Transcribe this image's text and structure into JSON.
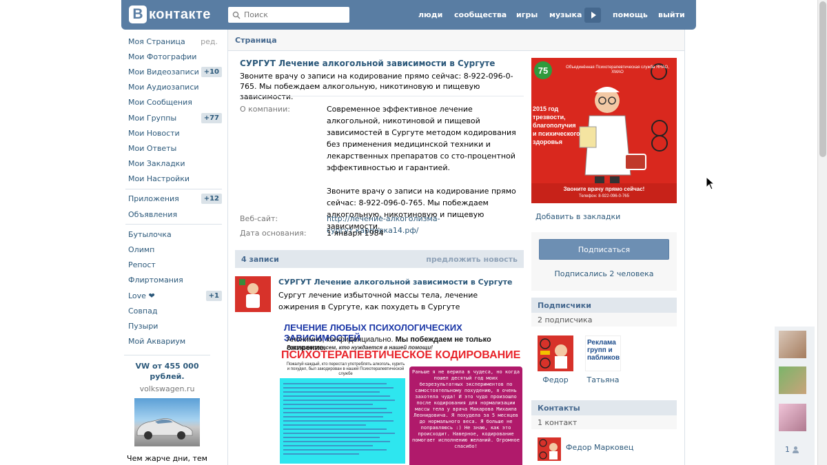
{
  "header": {
    "logo_letter": "В",
    "logo_text": "контакте",
    "search_placeholder": "Поиск",
    "nav": [
      "люди",
      "сообщества",
      "игры",
      "музыка",
      "помощь",
      "выйти"
    ]
  },
  "left_menu": {
    "group1": [
      {
        "label": "Моя Страница",
        "extra": "ред."
      },
      {
        "label": "Мои Фотографии"
      },
      {
        "label": "Мои Видеозаписи",
        "count": "+10"
      },
      {
        "label": "Мои Аудиозаписи"
      },
      {
        "label": "Мои Сообщения"
      },
      {
        "label": "Мои Группы",
        "count": "+77"
      },
      {
        "label": "Мои Новости"
      },
      {
        "label": "Мои Ответы"
      },
      {
        "label": "Мои Закладки"
      },
      {
        "label": "Мои Настройки"
      }
    ],
    "group2": [
      {
        "label": "Приложения",
        "count": "+12"
      },
      {
        "label": "Объявления"
      }
    ],
    "group3": [
      {
        "label": "Бутылочка"
      },
      {
        "label": "Олимп"
      },
      {
        "label": "Репост"
      },
      {
        "label": "Флиртомания"
      },
      {
        "label": "Love ❤",
        "count": "+1"
      },
      {
        "label": "Совпад"
      },
      {
        "label": "Пузыри"
      },
      {
        "label": "Мой Аквариум"
      }
    ]
  },
  "ad": {
    "title": "VW от 455 000 рублей.",
    "domain": "volkswagen.ru",
    "text": "Чем жарче дни, тем"
  },
  "main": {
    "bar_title": "Страница",
    "page_title": "СУРГУТ Лечение алкогольной зависимости в Сургуте",
    "status": "Звоните врачу о записи на кодирование прямо сейчас: 8-922-096-0-765. Мы побеждаем алкогольную, никотиновую и пищевую зависимости.",
    "about_label": "О компании:",
    "about_p1": "Современное эффективное лечение алкогольной, никотиновой и пищевой зависимостей в Сургуте методом кодирования без применения медицинской техники и лекарственных препаратов со сто-процентной эффективностью и гарантией.",
    "about_p2": "Звоните врачу о записи на кодирование прямо сейчас: 8-922-096-0-765. Мы побеждаем алкогольную, никотиновую и пищевую зависимости.",
    "website_label": "Веб-сайт:",
    "website": "http://лечение-алкоголизма-сургут.карповка14.рф/",
    "founded_label": "Дата основания:",
    "founded": "1 января 1984"
  },
  "posts": {
    "count_label": "4 записи",
    "suggest_label": "предложить новость",
    "post": {
      "author": "СУРГУТ Лечение алкогольной зависимости в Сургуте",
      "text": "Сургут лечение избыточной массы тела, лечение ожирения в Сургуте, как похудеть в Сургуте",
      "image": {
        "h1": "ЛЕЧЕНИЕ ЛЮБЫХ ПСИХОЛОГИЧЕСКИХ ЗАВИСИМОСТЕЙ",
        "h2a": "Анонимно, конфиденциально.",
        "h2b": "Мы побеждаем не только ожирение.",
        "h3": "Расскажите всем, кто нуждается в нашей помощи!",
        "h4": "ПСИХОТЕРАПЕВТИЧЕСКОЕ КОДИРОВАНИЕ",
        "small": "Пожалуй каждый, кто перестал употреблять алкоголь, курить и похудел, был закодирован в нашей Психотерапевтической службе",
        "testimonial": "Раньше я не верила в чудеса, но когда пошел десятый год моих безрезультатных экспериментов по самостоятельному похудению, я очень захотела чуда! И это чудо произошло после кодирования для нормализации массы тела у врача Макарова Михаила Леонидовича. Я похудела за 5 месяцев до нормального веса. Я больше не поправляюсь :) Не знаю, как это происходит. Наверное, кодирование помогает исполнению желаний. Огромное спасибо!"
      }
    }
  },
  "right": {
    "poster": {
      "badge": "75",
      "org": "Объединённая Психотерапевтическая служба ЯНАО, ХМАО",
      "slogan": "2015 год трезвости, благополучия и психического здоровья",
      "call": "Звоните врачу прямо сейчас!",
      "phone": "Телефон: 8-922-096-0-765"
    },
    "bookmark": "Добавить в закладки",
    "subscribe_button": "Подписаться",
    "subscribed_count": "Подписались 2 человека",
    "subscribers_title": "Подписчики",
    "subscribers_sub": "2 подписчика",
    "subscribers": [
      {
        "name": "Федор"
      },
      {
        "name": "Татьяна",
        "avatar_text": "Реклама групп и пабликов"
      }
    ],
    "contacts_title": "Контакты",
    "contacts_sub": "1 контакт",
    "contact_name": "Федор Марковец"
  },
  "friends_online": {
    "count": "1"
  },
  "colors": {
    "header": "#597da3",
    "link": "#2b587a",
    "panel": "#e1e7ed",
    "accent_red": "#d9281e"
  }
}
